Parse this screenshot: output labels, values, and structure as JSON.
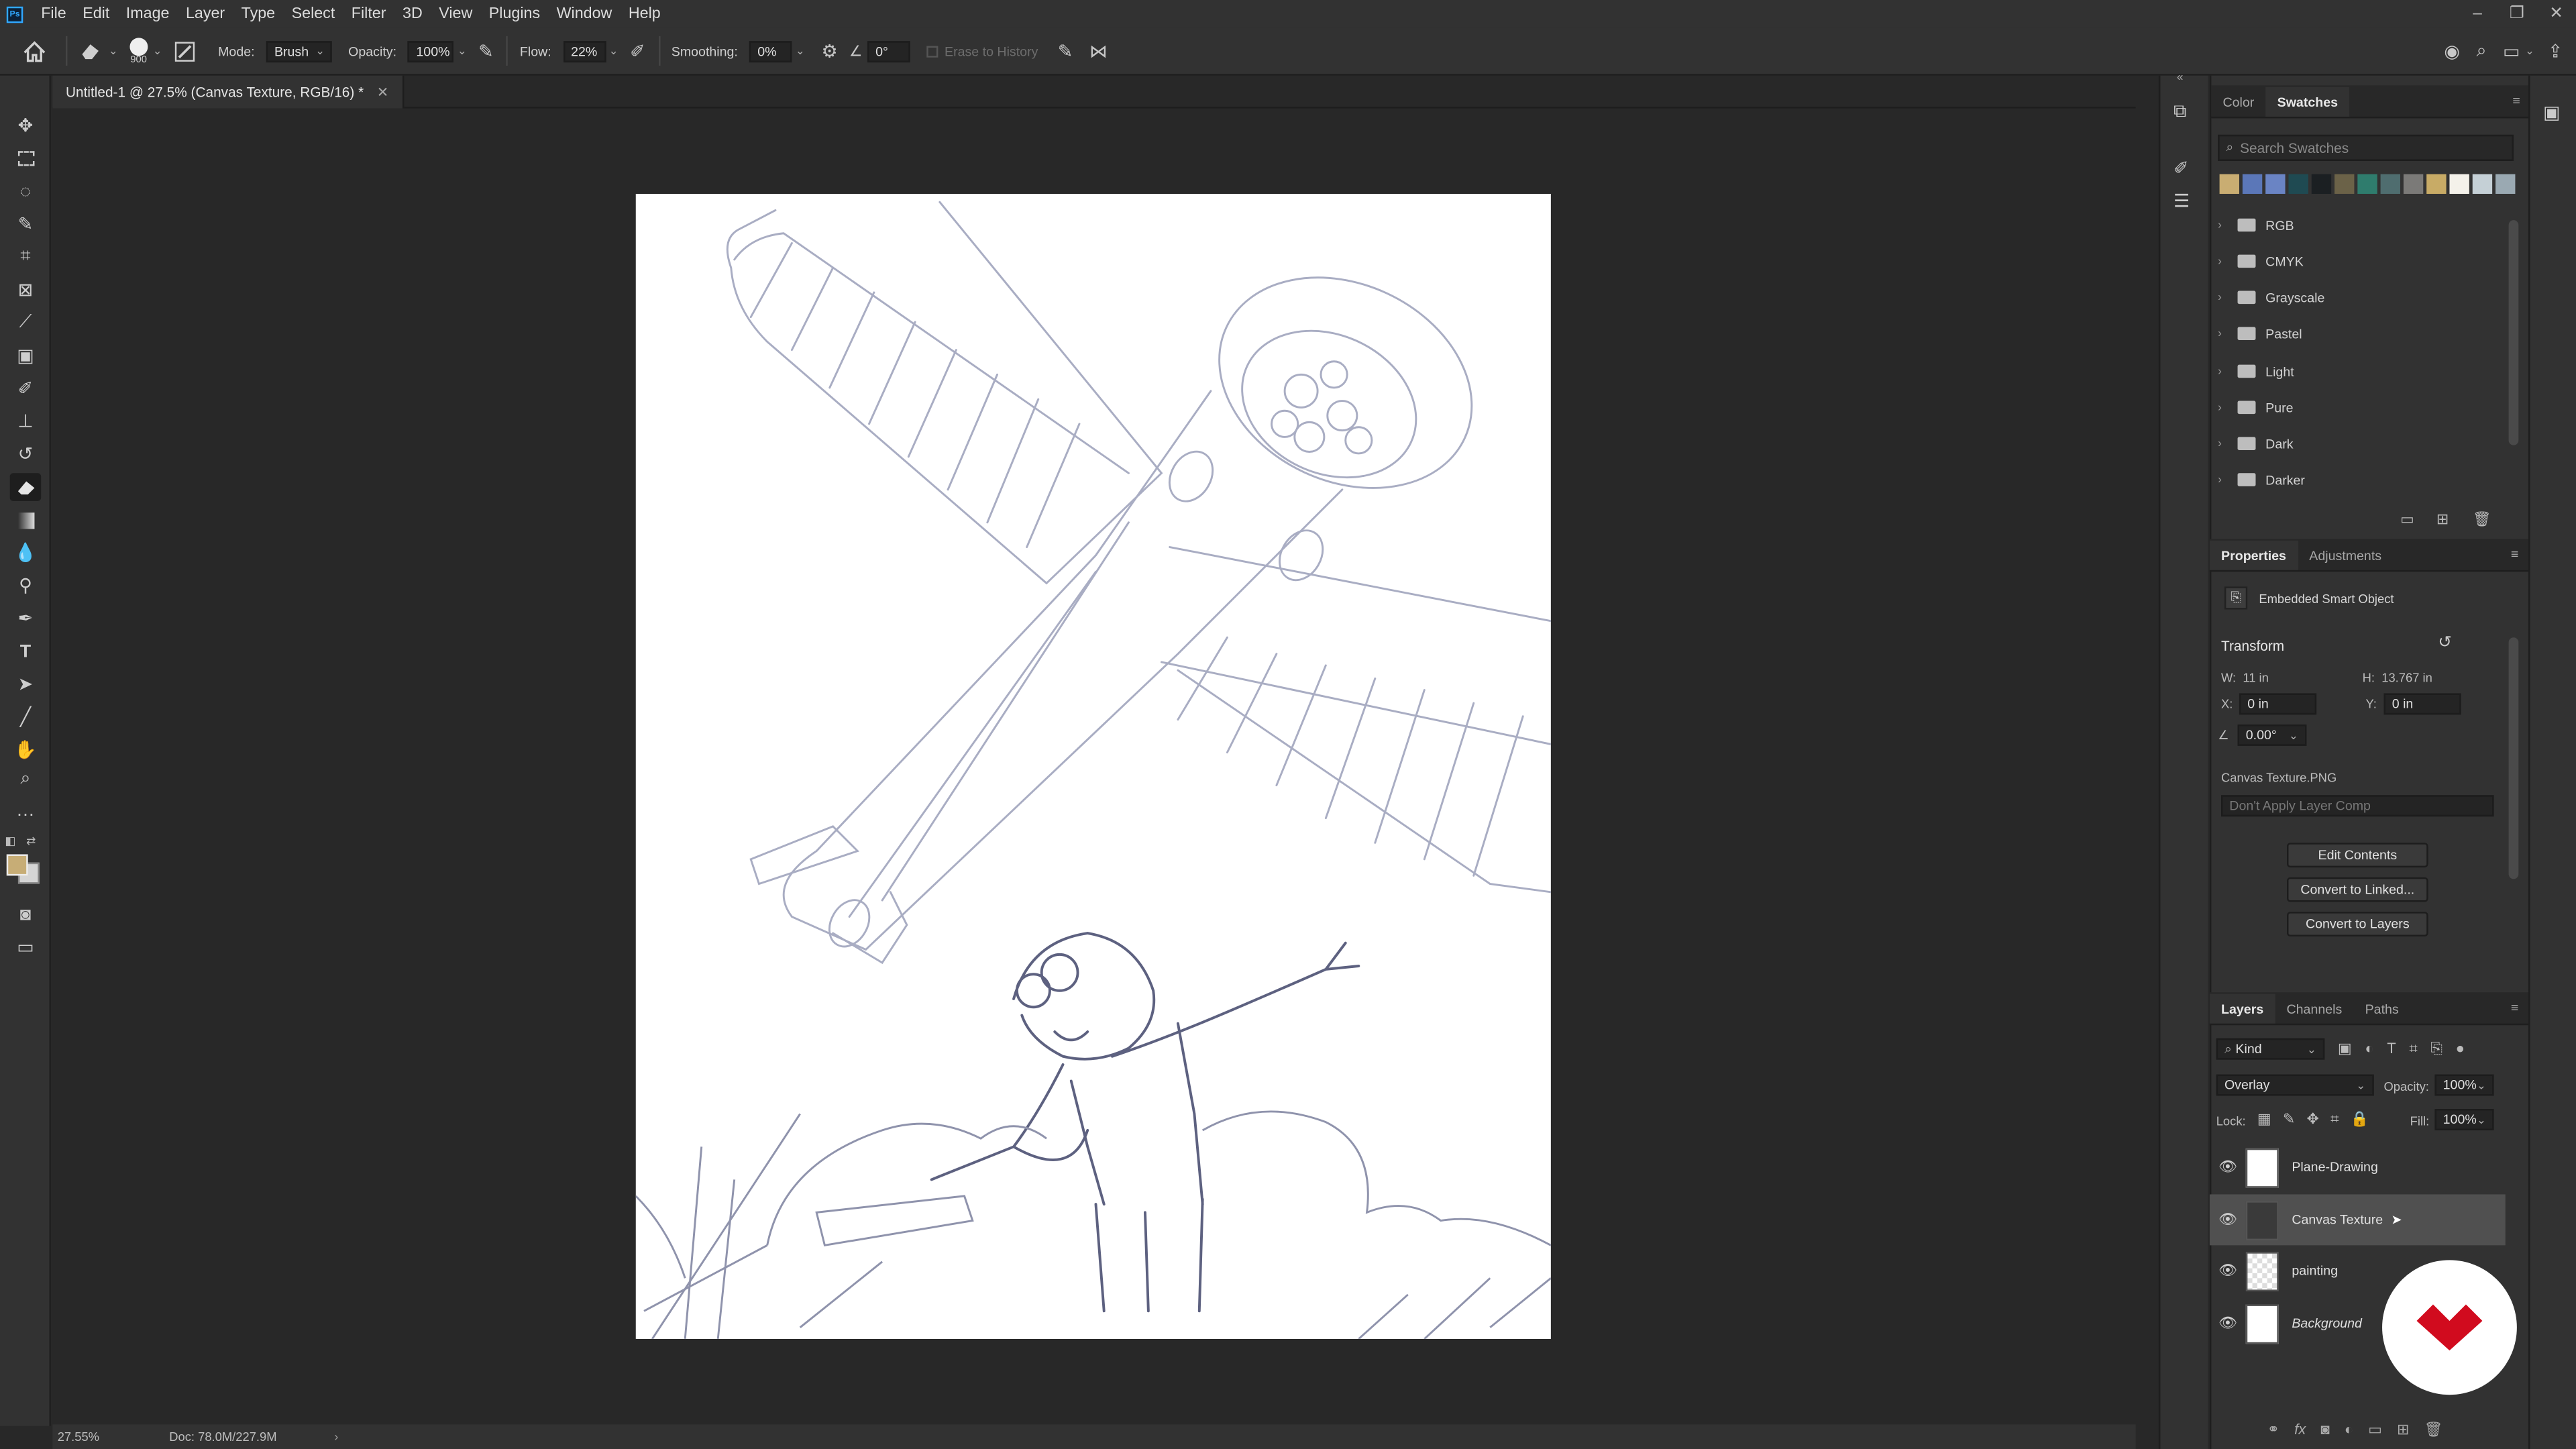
{
  "menu": {
    "items": [
      "File",
      "Edit",
      "Image",
      "Layer",
      "Type",
      "Select",
      "Filter",
      "3D",
      "View",
      "Plugins",
      "Window",
      "Help"
    ]
  },
  "options": {
    "brush_size": "900",
    "mode_label": "Mode:",
    "mode_value": "Brush",
    "opacity_label": "Opacity:",
    "opacity_value": "100%",
    "flow_label": "Flow:",
    "flow_value": "22%",
    "smoothing_label": "Smoothing:",
    "smoothing_value": "0%",
    "angle_value": "0°",
    "erase_history_label": "Erase to History"
  },
  "document": {
    "tab_title": "Untitled-1 @ 27.5% (Canvas Texture, RGB/16) *"
  },
  "status": {
    "zoom": "27.55%",
    "doc_size": "Doc: 78.0M/227.9M"
  },
  "swatches_panel": {
    "tabs": [
      "Color",
      "Swatches"
    ],
    "search_placeholder": "Search Swatches",
    "colors": [
      "#c9ad72",
      "#5b77b8",
      "#6a84c4",
      "#1f4a52",
      "#1b1f22",
      "#6b6248",
      "#2f7c6d",
      "#4f6d6f",
      "#7b7a78",
      "#c8ab66",
      "#f4f1ea",
      "#c5d0d6",
      "#9aa9b2"
    ],
    "folders": [
      "RGB",
      "CMYK",
      "Grayscale",
      "Pastel",
      "Light",
      "Pure",
      "Dark",
      "Darker"
    ]
  },
  "properties_panel": {
    "tabs": [
      "Properties",
      "Adjustments"
    ],
    "object_type": "Embedded Smart Object",
    "transform_label": "Transform",
    "w": "11 in",
    "h": "13.767 in",
    "x": "0 in",
    "y": "0 in",
    "angle": "0.00°",
    "file_name": "Canvas Texture.PNG",
    "layer_comp": "Don't Apply Layer Comp",
    "buttons": [
      "Edit Contents",
      "Convert to Linked...",
      "Convert to Layers"
    ]
  },
  "layers_panel": {
    "tabs": [
      "Layers",
      "Channels",
      "Paths"
    ],
    "filter_kind": "Kind",
    "blend_mode": "Overlay",
    "opacity_label": "Opacity:",
    "opacity_value": "100%",
    "lock_label": "Lock:",
    "fill_label": "Fill:",
    "fill_value": "100%",
    "layers": [
      "Plane-Drawing",
      "Canvas Texture",
      "painting",
      "Background"
    ]
  },
  "colors": {
    "foreground": "#c7ad76",
    "background": "#d5d5d5",
    "badge": "#d10b1e"
  }
}
